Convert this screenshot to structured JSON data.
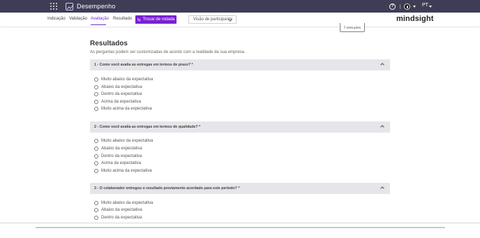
{
  "app": {
    "name": "Desempenho",
    "language": "PT",
    "brand": "mindsight"
  },
  "nav": {
    "items": [
      "Indicação",
      "Validação",
      "Avaliação",
      "Resultado"
    ],
    "active": "Avaliação",
    "switch_button": "Trocar de rodada",
    "view_select": "Visão de participante"
  },
  "instructions_label": "Instruções",
  "section": {
    "title": "Resultados",
    "subtitle": "As perguntas podem ser customizadas de acordo com a realidade da sua empresa"
  },
  "questions": [
    {
      "title": "1 - Como você avalia as entregas em termos de prazo? *",
      "options": [
        "Muito abaixo da expectativa",
        "Abaixo da expectativa",
        "Dentro da expectativa",
        "Acima da expectativa",
        "Muito acima da expectativa"
      ]
    },
    {
      "title": "2 - Como você avalia as entregas em termos de qualidade? *",
      "options": [
        "Muito abaixo da expectativa",
        "Abaixo da expectativa",
        "Dentro da expectativa",
        "Acima da expectativa",
        "Muito acima da expectativa"
      ]
    },
    {
      "title": "3 - O colaborador entregou o resultado previamente acordado para este período? *",
      "options": [
        "Muito abaixo da expectativa",
        "Abaixo da expectativa",
        "Dentro da expectativa"
      ]
    }
  ],
  "colors": {
    "topbar": "#3f3d56",
    "accent": "#7a1fd6",
    "question_header": "#e6e6ea"
  }
}
